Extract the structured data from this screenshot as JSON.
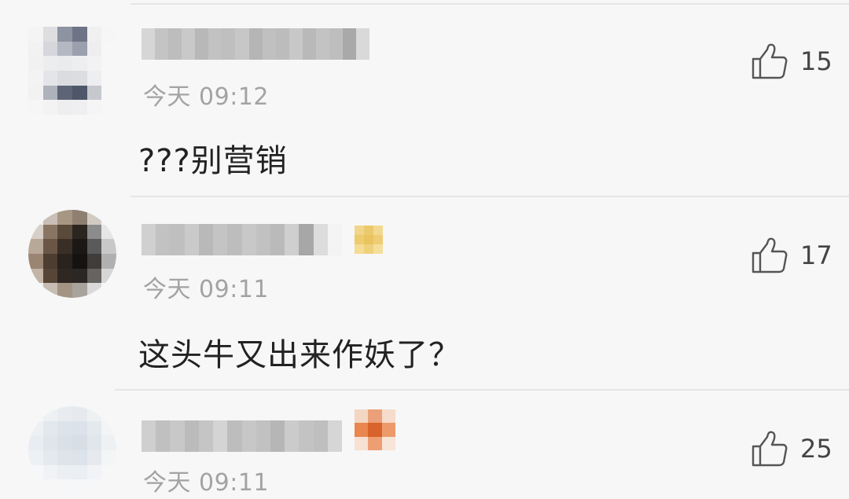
{
  "comments": [
    {
      "time": "今天 09:12",
      "text": "???别营销",
      "likes": "15",
      "avatar_colors": [
        "#f4f4f4",
        "#dedee0",
        "#8d93a0",
        "#6e7485",
        "#f0f0f1",
        "#f6f6f6",
        "#f2f2f3",
        "#d5d7dc",
        "#b3b8c2",
        "#9aa0ad",
        "#eeeef0",
        "#f7f7f7",
        "#f1f1f2",
        "#ecedef",
        "#eaebed",
        "#eeeef0",
        "#f2f2f3",
        "#f7f7f7",
        "#f3f3f4",
        "#e4e5e8",
        "#dadce0",
        "#dcdde1",
        "#eeeef0",
        "#f7f7f7",
        "#f2f2f3",
        "#aeb2bb",
        "#5d6476",
        "#4e566a",
        "#c6c8ce",
        "#f7f7f7",
        "#f6f6f6",
        "#f3f3f4",
        "#eeeef0",
        "#efeff1",
        "#f5f5f6",
        "#f7f7f7"
      ],
      "name_colors": [
        "#d6d6d6",
        "#c4c4c4",
        "#bdbdbd",
        "#c9c9c9",
        "#b8b8b8",
        "#c2c2c2",
        "#bfbfbf",
        "#c7c7c7",
        "#b5b5b5",
        "#c0c0c0",
        "#bcbcbc",
        "#c8c8c8",
        "#b9b9b9",
        "#c3c3c3",
        "#bebebe",
        "#a9a9a9",
        "#d9d9d9"
      ]
    },
    {
      "time": "今天 09:11",
      "text": "这头牛又出来作妖了？",
      "likes": "17",
      "avatar_colors": [
        "#efefef",
        "#c9bfb6",
        "#a89684",
        "#8f7f70",
        "#d2cbc4",
        "#f5f5f5",
        "#d7cfc8",
        "#8a7564",
        "#5a4a3c",
        "#2b2520",
        "#8c8c8c",
        "#e6e6e6",
        "#b8a898",
        "#6b5646",
        "#3a2f27",
        "#1c1816",
        "#5a5a5a",
        "#c8c8c8",
        "#9a8573",
        "#4d3d31",
        "#2a221c",
        "#151312",
        "#3f3c3a",
        "#b0b0b0",
        "#c2b4a6",
        "#574638",
        "#2f2721",
        "#2b2724",
        "#666360",
        "#d6d6d6",
        "#efefef",
        "#c8bdb2",
        "#a39484",
        "#a9a39d",
        "#d9d9d9",
        "#f5f5f5"
      ],
      "name_colors": [
        "#d0d0d0",
        "#c2c2c2",
        "#bfbfbf",
        "#cacaca",
        "#b9b9b9",
        "#c4c4c4",
        "#bdbdbd",
        "#c8c8c8",
        "#c1c1c1",
        "#bababa",
        "#cfcfcf",
        "#a7a7a7",
        "#dcdcdc",
        "#f3f3f3"
      ],
      "badge_colors": [
        "#f1d58a",
        "#ecc96b",
        "#f3d98f",
        "#eecb6e",
        "#e9c461",
        "#efcd74",
        "#f4dc94",
        "#efd07b",
        "#f5df9a"
      ]
    },
    {
      "time": "今天 09:11",
      "text": "",
      "likes": "25",
      "avatar_colors": [
        "#f5f6f7",
        "#eef1f4",
        "#e8ecf0",
        "#e6eaef",
        "#eef1f4",
        "#f6f7f8",
        "#eef1f4",
        "#e3e8ee",
        "#dde3ea",
        "#dbe2e9",
        "#e4e9ee",
        "#f2f4f6",
        "#e9edf1",
        "#dfe5eb",
        "#d9e0e8",
        "#d7dee6",
        "#e0e6ec",
        "#eef1f4",
        "#eef1f4",
        "#e4e9ee",
        "#dee4ea",
        "#dde3ea",
        "#e6eaef",
        "#f3f5f7",
        "#f6f7f8",
        "#f0f2f5",
        "#ebeff2",
        "#ebeef2",
        "#f1f3f6",
        "#f7f7f7",
        "#f7f7f7",
        "#f7f7f7",
        "#f6f7f8",
        "#f6f7f8",
        "#f7f7f7",
        "#f7f7f7"
      ],
      "name_colors": [
        "#cfcfcf",
        "#c0c0c0",
        "#c8c8c8",
        "#bbbbbb",
        "#c5c5c5",
        "#d4d4d4",
        "#bdbdbd",
        "#c7c7c7",
        "#c1c1c1",
        "#b6b6b6",
        "#cbcbcb",
        "#c3c3c3",
        "#bfbfbf",
        "#d6d6d6"
      ],
      "badge_colors": [
        "#f4d7c2",
        "#eba079",
        "#f5dccb",
        "#e9874f",
        "#d8642b",
        "#ec9a6c",
        "#f6e1d3",
        "#ed9f73",
        "#f7e5d8"
      ]
    }
  ]
}
